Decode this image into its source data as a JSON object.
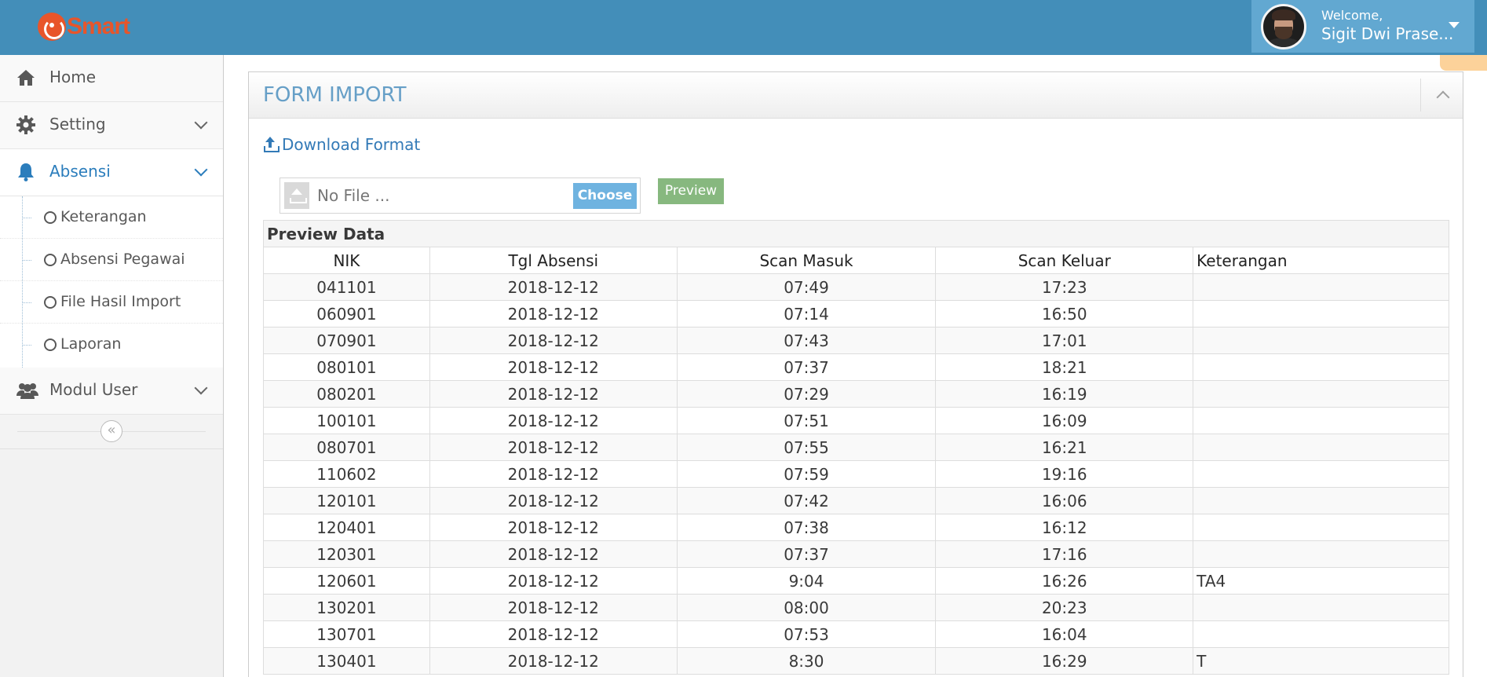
{
  "brand": {
    "name": "Smart"
  },
  "user": {
    "welcome": "Welcome,",
    "name": "Sigit Dwi Prase..."
  },
  "sidebar": {
    "items": [
      {
        "label": "Home",
        "icon": "home-icon"
      },
      {
        "label": "Setting",
        "icon": "gear-icon"
      },
      {
        "label": "Absensi",
        "icon": "bell-icon",
        "active": true
      },
      {
        "label": "Modul User",
        "icon": "users-icon"
      }
    ],
    "submenu": [
      {
        "label": "Keterangan"
      },
      {
        "label": "Absensi Pegawai"
      },
      {
        "label": "File Hasil Import"
      },
      {
        "label": "Laporan"
      }
    ]
  },
  "widget": {
    "title": "FORM IMPORT"
  },
  "download": {
    "label": "Download Format"
  },
  "file_input": {
    "placeholder": "No File ...",
    "choose_label": "Choose"
  },
  "preview_button": {
    "label": "Preview"
  },
  "table": {
    "title": "Preview Data",
    "columns": [
      "NIK",
      "Tgl Absensi",
      "Scan Masuk",
      "Scan Keluar",
      "Keterangan"
    ],
    "rows": [
      [
        "041101",
        "2018-12-12",
        "07:49",
        "17:23",
        ""
      ],
      [
        "060901",
        "2018-12-12",
        "07:14",
        "16:50",
        ""
      ],
      [
        "070901",
        "2018-12-12",
        "07:43",
        "17:01",
        ""
      ],
      [
        "080101",
        "2018-12-12",
        "07:37",
        "18:21",
        ""
      ],
      [
        "080201",
        "2018-12-12",
        "07:29",
        "16:19",
        ""
      ],
      [
        "100101",
        "2018-12-12",
        "07:51",
        "16:09",
        ""
      ],
      [
        "080701",
        "2018-12-12",
        "07:55",
        "16:21",
        ""
      ],
      [
        "110602",
        "2018-12-12",
        "07:59",
        "19:16",
        ""
      ],
      [
        "120101",
        "2018-12-12",
        "07:42",
        "16:06",
        ""
      ],
      [
        "120401",
        "2018-12-12",
        "07:38",
        "16:12",
        ""
      ],
      [
        "120301",
        "2018-12-12",
        "07:37",
        "17:16",
        ""
      ],
      [
        "120601",
        "2018-12-12",
        "9:04",
        "16:26",
        "TA4"
      ],
      [
        "130201",
        "2018-12-12",
        "08:00",
        "20:23",
        ""
      ],
      [
        "130701",
        "2018-12-12",
        "07:53",
        "16:04",
        ""
      ],
      [
        "130401",
        "2018-12-12",
        "8:30",
        "16:29",
        "T"
      ]
    ]
  }
}
